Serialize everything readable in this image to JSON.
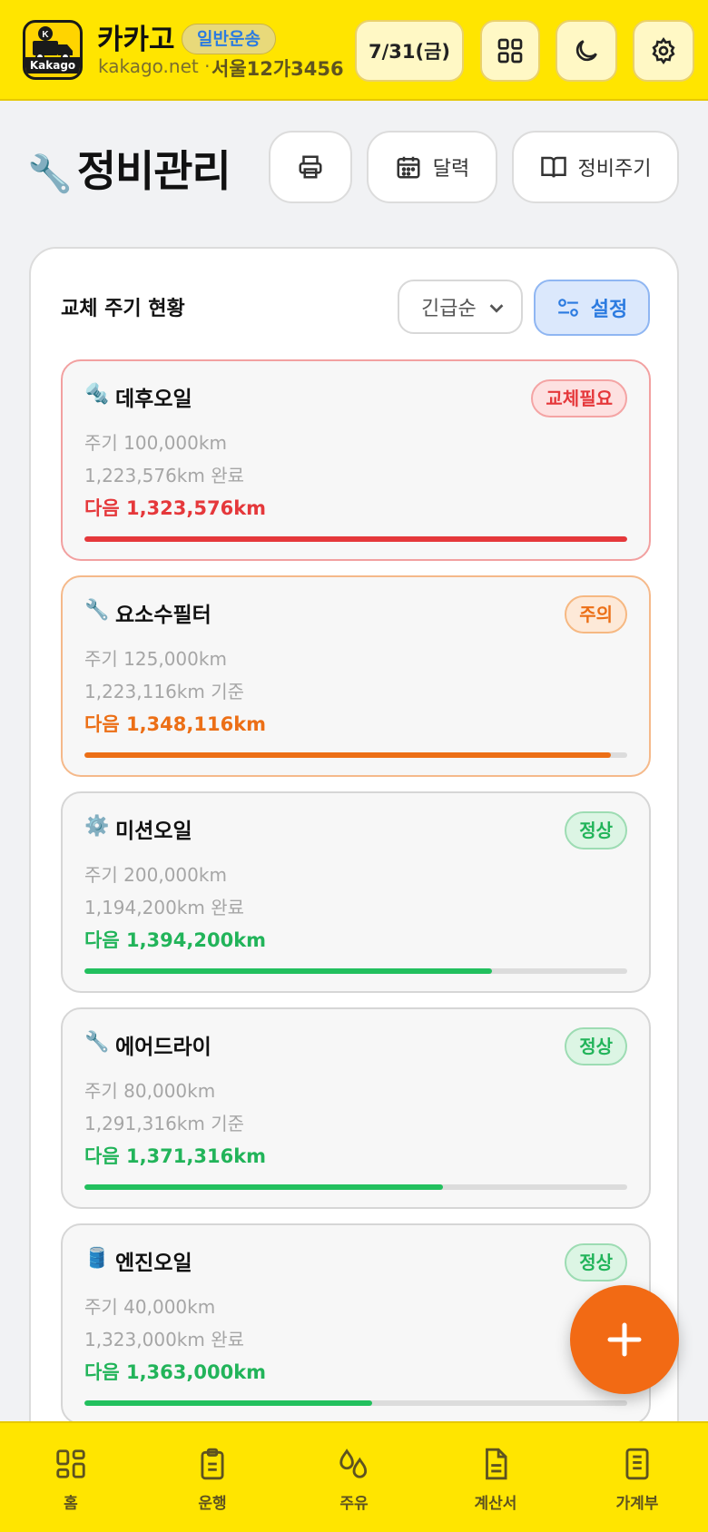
{
  "header": {
    "app_name": "카카고",
    "service_badge": "일반운송",
    "logo_text": "Kakago",
    "domain": "kakago.net",
    "separator": "·",
    "plate": "서울12가3456",
    "date": "7/31(금)"
  },
  "toolbar": {
    "title": "정비관리",
    "calendar_label": "달력",
    "cycle_label": "정비주기"
  },
  "panel": {
    "title": "교체 주기 현황",
    "sort_value": "긴급순",
    "setting_label": "설정"
  },
  "items": [
    {
      "icon": "🔩",
      "name": "데후오일",
      "status": "교체필요",
      "level": "danger",
      "cycle": "주기 100,000km",
      "last": "1,223,576km 완료",
      "next": "다음 1,323,576km",
      "progress": 1.0
    },
    {
      "icon": "🔧",
      "name": "요소수필터",
      "status": "주의",
      "level": "warn",
      "cycle": "주기 125,000km",
      "last": "1,223,116km 기준",
      "next": "다음 1,348,116km",
      "progress": 0.97
    },
    {
      "icon": "⚙️",
      "name": "미션오일",
      "status": "정상",
      "level": "ok",
      "cycle": "주기 200,000km",
      "last": "1,194,200km 완료",
      "next": "다음 1,394,200km",
      "progress": 0.75
    },
    {
      "icon": "🔧",
      "name": "에어드라이",
      "status": "정상",
      "level": "ok",
      "cycle": "주기 80,000km",
      "last": "1,291,316km 기준",
      "next": "다음 1,371,316km",
      "progress": 0.66
    },
    {
      "icon": "🛢️",
      "name": "엔진오일",
      "status": "정상",
      "level": "ok",
      "cycle": "주기 40,000km",
      "last": "1,323,000km 완료",
      "next": "다음 1,363,000km",
      "progress": 0.53
    }
  ],
  "nav": [
    {
      "label": "홈",
      "icon": "grid-icon"
    },
    {
      "label": "운행",
      "icon": "clipboard-icon"
    },
    {
      "label": "주유",
      "icon": "fuel-drop-icon"
    },
    {
      "label": "계산서",
      "icon": "document-icon"
    },
    {
      "label": "가계부",
      "icon": "ledger-icon"
    }
  ],
  "colors": {
    "brand_yellow": "#FFE500",
    "danger": "#E5383B",
    "warn": "#EC6F16",
    "ok": "#22C05E",
    "accent_blue": "#2C7BE0",
    "fab": "#F26A14"
  }
}
